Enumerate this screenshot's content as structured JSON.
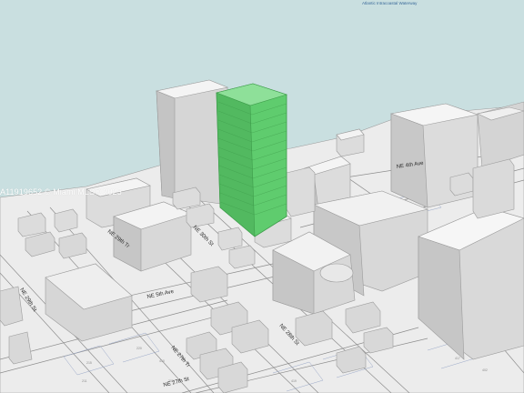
{
  "map": {
    "water_label": "Atlantic Intracoastal Waterway",
    "watermark": "A11919652 © Miami MLS® 2025",
    "streets": [
      "NE 29th Tr",
      "NE 29th St",
      "NE 30th St",
      "NE 28th St",
      "NE 5th Ave",
      "NE 27th Tr",
      "NE 4th Ave",
      "NE 27th St"
    ],
    "lots": [
      "220",
      "215",
      "410",
      "203",
      "211",
      "424",
      "431",
      "417",
      "425",
      "419",
      "402",
      "396"
    ],
    "colors": {
      "water": "#c9dfe0",
      "ground": "#ececec",
      "building": "#dcdcdc",
      "highlight": "#5fcc6e"
    }
  }
}
